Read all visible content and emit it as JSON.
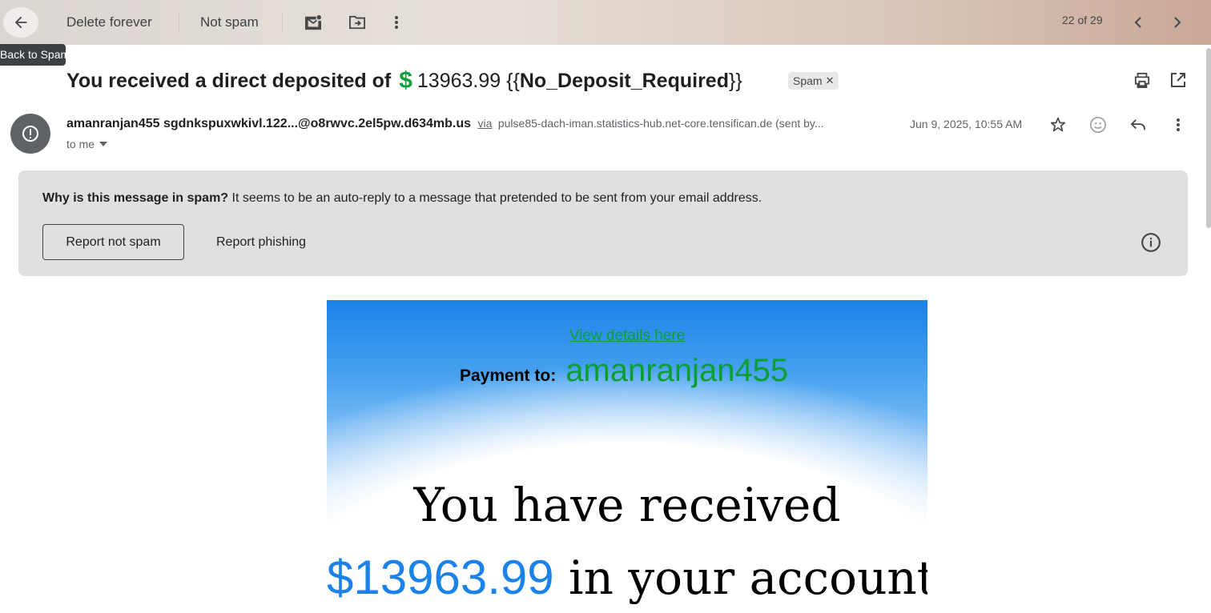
{
  "toolbar": {
    "back_tooltip": "Back to Spam",
    "delete_forever": "Delete forever",
    "not_spam": "Not spam",
    "counter": "22 of 29"
  },
  "message": {
    "subject_prefix": "You received a direct deposited of ",
    "subject_dollar": "$",
    "subject_amount": "13963.99 {{",
    "subject_tag": "No_Deposit_Required",
    "subject_close": "}}",
    "label": "Spam",
    "sender_name": "amanranjan455",
    "sender_email": "sgdnkspuxwkivl.122...@o8rwvc.2el5pw.d634mb.us",
    "via": "via",
    "via_domain": "pulse85-dach-iman.statistics-hub.net-core.tensifican.de (sent by...",
    "date": "Jun 9, 2025, 10:55 AM",
    "to": "to me"
  },
  "spam_banner": {
    "question": "Why is this message in spam?",
    "reason": " It seems to be an auto-reply to a message that pretended to be sent from your email address.",
    "report_not_spam": "Report not spam",
    "report_phishing": "Report phishing"
  },
  "email_body": {
    "link": "View details here",
    "payment_label": "Payment to:",
    "payment_name": "amanranjan455",
    "line1": "You have received",
    "amount": "$13963.99",
    "line2_rest": " in your account"
  },
  "colors": {
    "accent_green": "#0a9f2e",
    "accent_blue": "#1a82e8",
    "banner_bg": "#e0e0e0"
  }
}
